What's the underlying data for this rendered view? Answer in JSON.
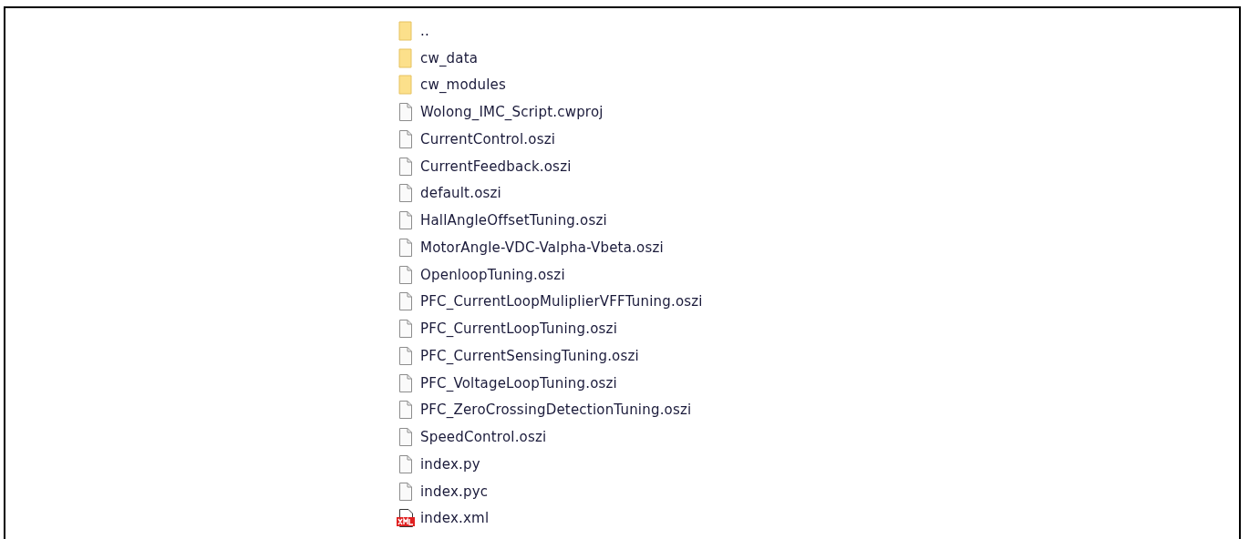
{
  "files": [
    {
      "name": "..",
      "kind": "folder"
    },
    {
      "name": "cw_data",
      "kind": "folder"
    },
    {
      "name": "cw_modules",
      "kind": "folder"
    },
    {
      "name": "Wolong_IMC_Script.cwproj",
      "kind": "file"
    },
    {
      "name": "CurrentControl.oszi",
      "kind": "file"
    },
    {
      "name": "CurrentFeedback.oszi",
      "kind": "file"
    },
    {
      "name": "default.oszi",
      "kind": "file"
    },
    {
      "name": "HallAngleOffsetTuning.oszi",
      "kind": "file"
    },
    {
      "name": "MotorAngle-VDC-Valpha-Vbeta.oszi",
      "kind": "file"
    },
    {
      "name": "OpenloopTuning.oszi",
      "kind": "file"
    },
    {
      "name": "PFC_CurrentLoopMuliplierVFFTuning.oszi",
      "kind": "file"
    },
    {
      "name": "PFC_CurrentLoopTuning.oszi",
      "kind": "file"
    },
    {
      "name": "PFC_CurrentSensingTuning.oszi",
      "kind": "file"
    },
    {
      "name": "PFC_VoltageLoopTuning.oszi",
      "kind": "file"
    },
    {
      "name": "PFC_ZeroCrossingDetectionTuning.oszi",
      "kind": "file"
    },
    {
      "name": "SpeedControl.oszi",
      "kind": "file"
    },
    {
      "name": "index.py",
      "kind": "file"
    },
    {
      "name": "index.pyc",
      "kind": "file"
    },
    {
      "name": "index.xml",
      "kind": "xml"
    }
  ]
}
